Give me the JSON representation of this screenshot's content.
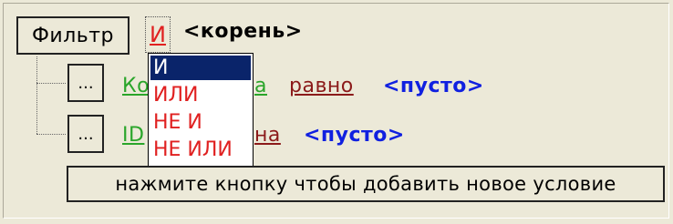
{
  "toolbar": {
    "filter_label": "Фильтр",
    "root_operator": "И",
    "root_label": "<корень>"
  },
  "conditions": [
    {
      "button_label": "...",
      "field_visible": "Ко",
      "field_tail": "а",
      "operator": "равно",
      "value": "<пусто>"
    },
    {
      "button_label": "...",
      "field_visible": "ID",
      "field_tail": "на",
      "value": "<пусто>"
    }
  ],
  "dropdown": {
    "items": [
      "И",
      "ИЛИ",
      "НЕ И",
      "НЕ ИЛИ"
    ],
    "selected": "И"
  },
  "hint": {
    "text": "нажмите кнопку чтобы добавить новое условие"
  },
  "colors": {
    "operator": "#e02020",
    "field": "#2aa52a",
    "comparison": "#8b1a1a",
    "value": "#1020e0",
    "selection": "#0a246a"
  }
}
